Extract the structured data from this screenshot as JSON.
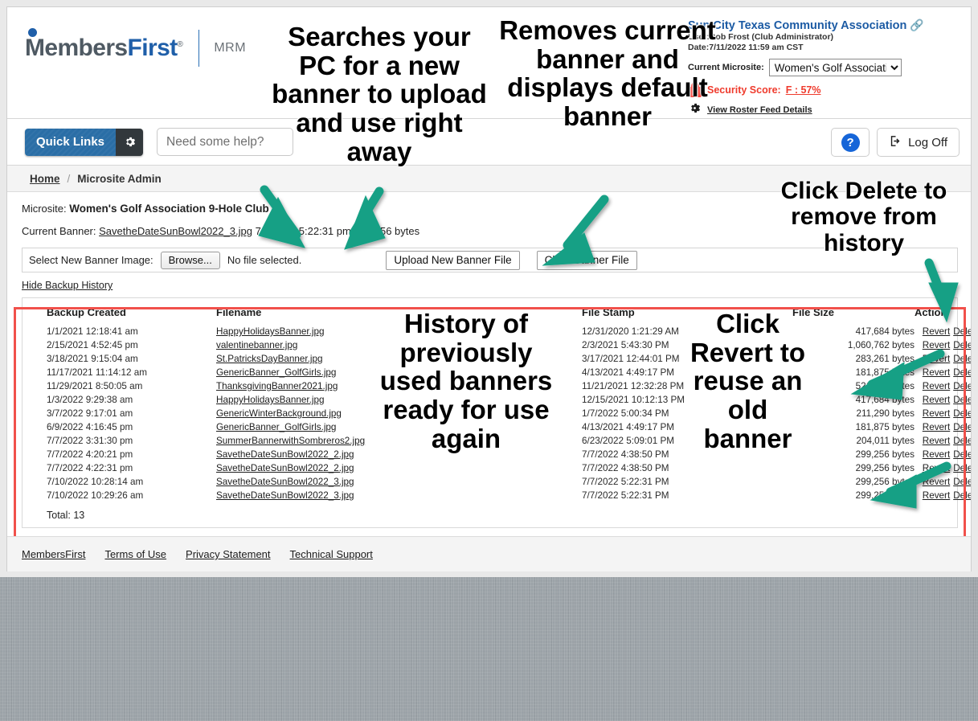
{
  "brand": {
    "logo_members": "Members",
    "logo_first": "First",
    "logo_reg": "®",
    "mrm": "MRM"
  },
  "header": {
    "club_name": "Sun City Texas Community Association",
    "link_glyph": "link-icon",
    "user_line": "User:Bob Frost (Club Administrator)",
    "date_line": "Date:7/11/2022 11:59 am CST",
    "microsite_label": "Current Microsite:",
    "microsite_value": "Women's Golf Associatio",
    "microsite_options": [
      "Women's Golf Associatio"
    ],
    "security_label": "Security Score:",
    "security_value": "F : 57%",
    "security_color": "#ef3b2d",
    "roster_link": "View Roster Feed Details"
  },
  "toolbar": {
    "quick_links_label": "Quick Links",
    "gear_icon": "gear-icon",
    "help_placeholder": "Need some help?",
    "help_button_glyph": "?",
    "logoff_label": "Log Off"
  },
  "breadcrumb": {
    "home": "Home",
    "separator": "/",
    "current": "Microsite Admin"
  },
  "main": {
    "microsite_label": "Microsite:",
    "microsite_name": "Women's Golf Association 9-Hole Club",
    "current_banner_label": "Current Banner:",
    "current_banner_file": "SavetheDateSunBowl2022_3.jpg",
    "current_banner_stamp": "7/7/2022 5:22:31 pm",
    "current_banner_size": "299,256 bytes",
    "select_label": "Select New Banner Image:",
    "browse_button": "Browse...",
    "no_file_text": "No file selected.",
    "upload_button": "Upload New Banner File",
    "clear_button": "Clear Banner File",
    "hide_history_link": "Hide Backup History"
  },
  "table": {
    "columns": [
      "Backup Created",
      "Filename",
      "File Stamp",
      "File Size",
      "Action"
    ],
    "revert_label": "Revert",
    "delete_label": "Delete",
    "total_label": "Total: 13",
    "rows": [
      {
        "created": "1/1/2021 12:18:41 am",
        "filename": "HappyHolidaysBanner.jpg",
        "stamp": "12/31/2020 1:21:29 AM",
        "size": "417,684 bytes"
      },
      {
        "created": "2/15/2021 4:52:45 pm",
        "filename": "valentinebanner.jpg",
        "stamp": "2/3/2021 5:43:30 PM",
        "size": "1,060,762 bytes"
      },
      {
        "created": "3/18/2021 9:15:04 am",
        "filename": "St.PatricksDayBanner.jpg",
        "stamp": "3/17/2021 12:44:01 PM",
        "size": "283,261 bytes"
      },
      {
        "created": "11/17/2021 11:14:12 am",
        "filename": "GenericBanner_GolfGirls.jpg",
        "stamp": "4/13/2021 4:49:17 PM",
        "size": "181,875 bytes"
      },
      {
        "created": "11/29/2021 8:50:05 am",
        "filename": "ThanksgivingBanner2021.jpg",
        "stamp": "11/21/2021 12:32:28 PM",
        "size": "521,898 bytes"
      },
      {
        "created": "1/3/2022 9:29:38 am",
        "filename": "HappyHolidaysBanner.jpg",
        "stamp": "12/15/2021 10:12:13 PM",
        "size": "417,684 bytes"
      },
      {
        "created": "3/7/2022 9:17:01 am",
        "filename": "GenericWinterBackground.jpg",
        "stamp": "1/7/2022 5:00:34 PM",
        "size": "211,290 bytes"
      },
      {
        "created": "6/9/2022 4:16:45 pm",
        "filename": "GenericBanner_GolfGirls.jpg",
        "stamp": "4/13/2021 4:49:17 PM",
        "size": "181,875 bytes"
      },
      {
        "created": "7/7/2022 3:31:30 pm",
        "filename": "SummerBannerwithSombreros2.jpg",
        "stamp": "6/23/2022 5:09:01 PM",
        "size": "204,011 bytes"
      },
      {
        "created": "7/7/2022 4:20:21 pm",
        "filename": "SavetheDateSunBowl2022_2.jpg",
        "stamp": "7/7/2022 4:38:50 PM",
        "size": "299,256 bytes"
      },
      {
        "created": "7/7/2022 4:22:31 pm",
        "filename": "SavetheDateSunBowl2022_2.jpg",
        "stamp": "7/7/2022 4:38:50 PM",
        "size": "299,256 bytes"
      },
      {
        "created": "7/10/2022 10:28:14 am",
        "filename": "SavetheDateSunBowl2022_3.jpg",
        "stamp": "7/7/2022 5:22:31 PM",
        "size": "299,256 bytes"
      },
      {
        "created": "7/10/2022 10:29:26 am",
        "filename": "SavetheDateSunBowl2022_3.jpg",
        "stamp": "7/7/2022 5:22:31 PM",
        "size": "299,256 bytes"
      }
    ]
  },
  "footer": {
    "links": [
      "MembersFirst",
      "Terms of Use",
      "Privacy Statement",
      "Technical Support"
    ]
  },
  "annotations": {
    "browse": "Searches your PC for a new banner to upload and use right away",
    "clear": "Removes current banner and displays default banner",
    "delete": "Click Delete to remove from history",
    "history": "History of previously used banners ready for use again",
    "revert": "Click Revert to reuse an old banner",
    "arrow_color": "#16a085"
  }
}
